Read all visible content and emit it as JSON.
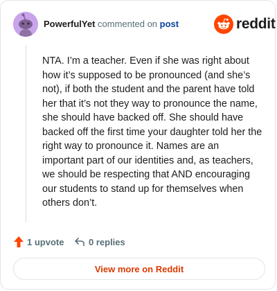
{
  "comment": {
    "author": "PowerfulYet",
    "action_text": " commented on ",
    "post_link_label": "post",
    "body": "NTA. I’m a teacher. Even if she was right about how it’s supposed to be pronounced (and she’s not), if both the student and the parent have told her that it’s not they way to pronounce the name, she should have backed off. She should have backed off the first time your daughter told her the right way to pronounce it. Names are an important part of our identities and, as teachers, we should be respecting that AND encouraging our students to stand up for themselves when others don’t."
  },
  "brand": {
    "name": "reddit",
    "color": "#ff4500",
    "icon": "reddit-snoo-icon"
  },
  "footer": {
    "upvote_label": "1 upvote",
    "upvote_icon": "upvote-arrow-icon",
    "upvote_color": "#ff4500",
    "replies_label": "0 replies",
    "replies_icon": "reply-icon",
    "view_more_label": "View more on Reddit",
    "view_more_color": "#d93a00"
  },
  "avatar": {
    "icon": "snoo-avatar-icon",
    "background": "#c9a4ea"
  }
}
